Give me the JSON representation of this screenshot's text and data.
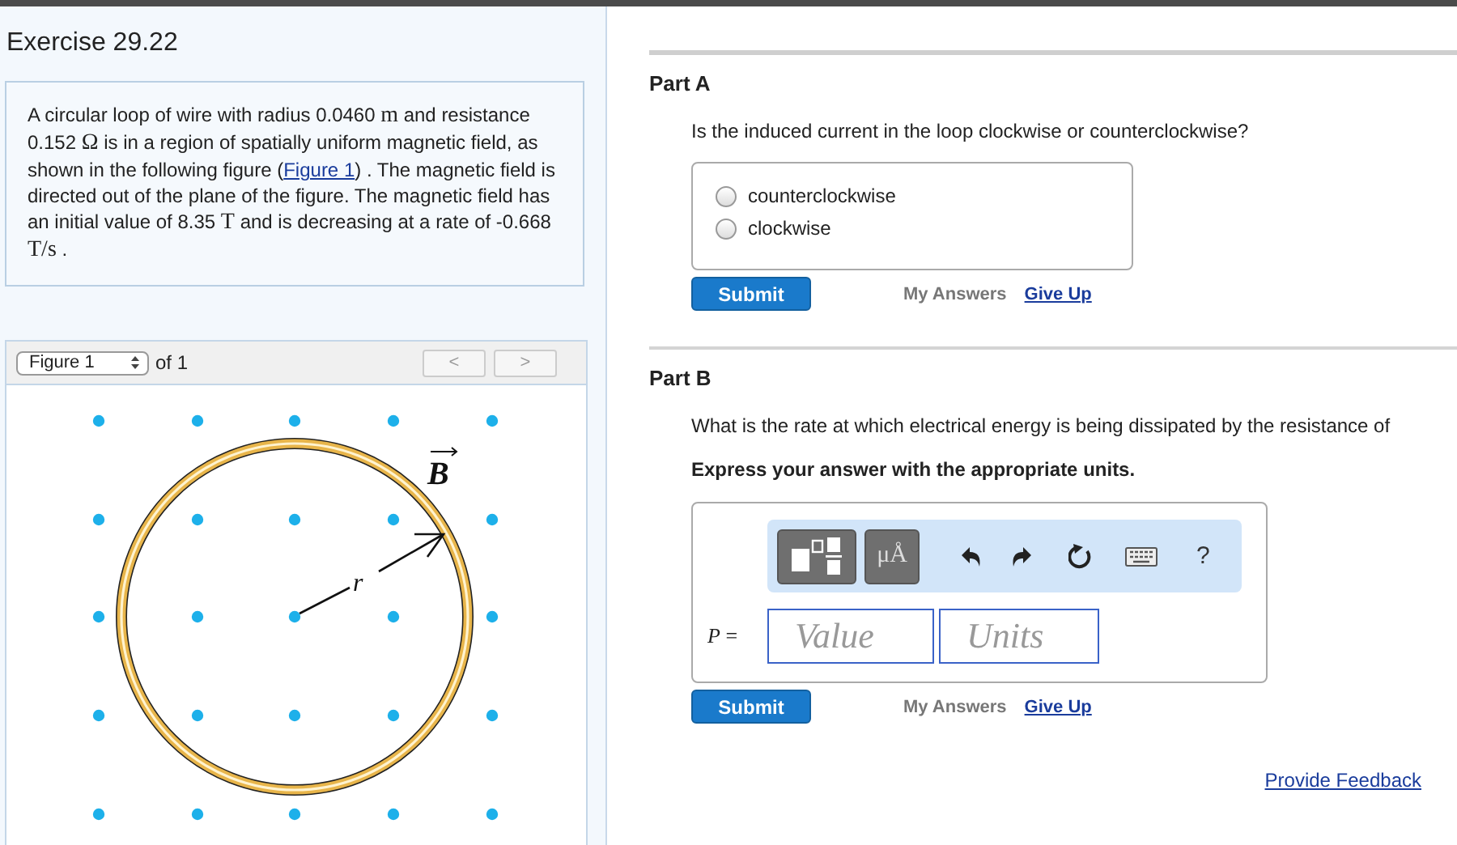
{
  "exercise": {
    "title": "Exercise 29.22",
    "problem": [
      {
        "kind": "text",
        "text": "A circular loop of wire with radius 0.0460 "
      },
      {
        "kind": "math",
        "text": "m"
      },
      {
        "kind": "text",
        "text": " and resistance 0.152 "
      },
      {
        "kind": "math",
        "text": "Ω"
      },
      {
        "kind": "text",
        "text": " is in a region of spatially uniform magnetic field, as shown in the following figure ("
      },
      {
        "kind": "link",
        "text": "Figure 1"
      },
      {
        "kind": "text",
        "text": ") . The magnetic field is directed out of the plane of the figure. The magnetic field has an initial value of 8.35 "
      },
      {
        "kind": "math",
        "text": "T"
      },
      {
        "kind": "text",
        "text": " and is decreasing at a rate of -0.668 "
      },
      {
        "kind": "math",
        "text": "T/s"
      },
      {
        "kind": "text",
        "text": " ."
      }
    ]
  },
  "figure_panel": {
    "selector": "Figure 1",
    "count": "of 1",
    "prev": {
      "label": "<",
      "disabled": true
    },
    "next": {
      "label": ">",
      "disabled": true
    },
    "field_label": "B",
    "radius_label": "r"
  },
  "parts": [
    {
      "kind": "choice",
      "title": "Part A",
      "question": "Is the induced current in the loop clockwise or counterclockwise?",
      "options": [
        {
          "label": "counterclockwise",
          "selected": false
        },
        {
          "label": "clockwise",
          "selected": false
        }
      ],
      "submit": "Submit",
      "my_answers": "My Answers",
      "give_up": "Give Up"
    },
    {
      "kind": "numeric",
      "title": "Part B",
      "question": "What is the rate at which electrical energy is being dissipated by the resistance of",
      "instruction": "Express your answer with the appropriate units.",
      "units_button": "μÅ",
      "help": "?",
      "variable": "*P* =",
      "value_placeholder": "Value",
      "units_placeholder": "Units",
      "submit": "Submit",
      "my_answers": "My Answers",
      "give_up": "Give Up"
    }
  ],
  "feedback_link": "Provide Feedback"
}
